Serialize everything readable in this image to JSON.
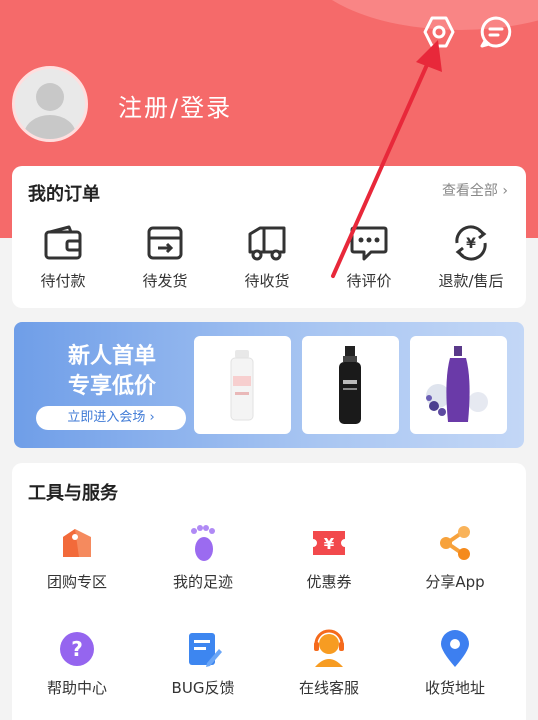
{
  "header": {
    "settings_icon": "settings-hex-icon",
    "message_icon": "message-bubble-icon",
    "login_text": "注册/登录"
  },
  "orders": {
    "title": "我的订单",
    "view_all": "查看全部",
    "items": [
      {
        "label": "待付款",
        "icon": "wallet-icon"
      },
      {
        "label": "待发货",
        "icon": "box-icon"
      },
      {
        "label": "待收货",
        "icon": "truck-icon"
      },
      {
        "label": "待评价",
        "icon": "comment-icon"
      },
      {
        "label": "退款/售后",
        "icon": "refund-icon"
      }
    ]
  },
  "banner": {
    "title_line1": "新人首单",
    "title_line2": "专享低价",
    "button_label": "立即进入会场"
  },
  "tools": {
    "title": "工具与服务",
    "items": [
      {
        "label": "团购专区",
        "icon": "group-buy-icon",
        "color": "#f58a5e"
      },
      {
        "label": "我的足迹",
        "icon": "footprint-icon",
        "color": "#9b6bf0"
      },
      {
        "label": "优惠券",
        "icon": "coupon-icon",
        "color": "#f2494c"
      },
      {
        "label": "分享App",
        "icon": "share-icon",
        "color": "#f7a23c"
      },
      {
        "label": "帮助中心",
        "icon": "help-icon",
        "color": "#9565ef"
      },
      {
        "label": "BUG反馈",
        "icon": "feedback-icon",
        "color": "#3d86f0"
      },
      {
        "label": "在线客服",
        "icon": "customer-service-icon",
        "color": "#f79c22"
      },
      {
        "label": "收货地址",
        "icon": "address-icon",
        "color": "#3d7ff0"
      }
    ]
  },
  "colors": {
    "header": "#f56a6a",
    "annotation_arrow": "#e8283a"
  }
}
